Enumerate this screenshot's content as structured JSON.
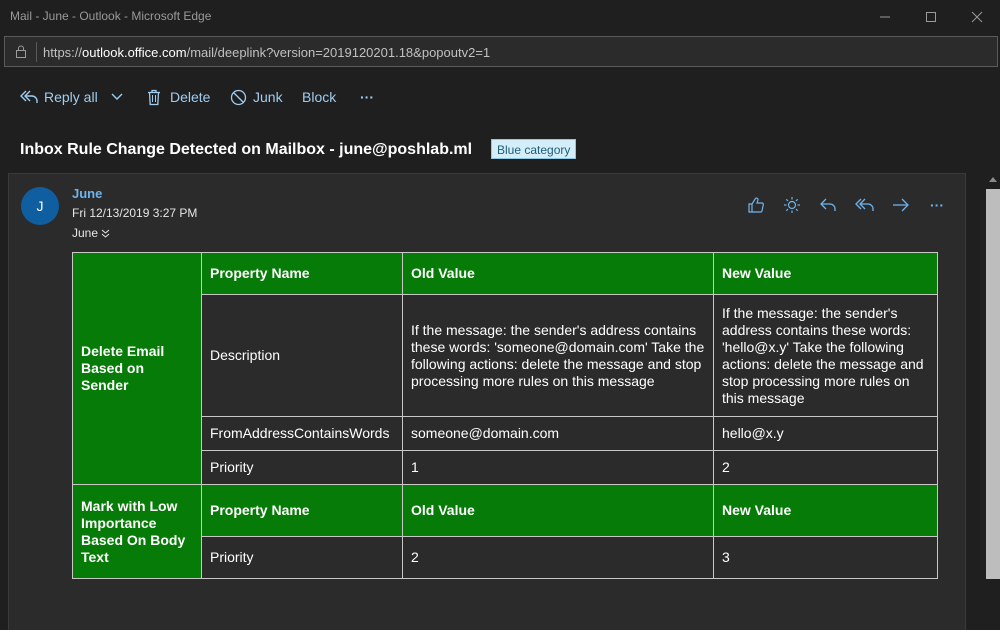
{
  "window": {
    "title": "Mail - June - Outlook - Microsoft Edge",
    "minimize_icon": "minimize-icon",
    "maximize_icon": "maximize-icon",
    "close_icon": "close-icon"
  },
  "address_bar": {
    "url_prefix": "https://",
    "url_host": "outlook.office.com",
    "url_path": "/mail/deeplink?version=2019120201.18&popoutv2=1"
  },
  "toolbar": {
    "reply_all": "Reply all",
    "delete": "Delete",
    "junk": "Junk",
    "block": "Block",
    "more": "···"
  },
  "message": {
    "subject": "Inbox Rule Change Detected on Mailbox - june@poshlab.ml",
    "category": "Blue category",
    "avatar_initial": "J",
    "sender": "June",
    "date": "Fri 12/13/2019 3:27 PM",
    "to": "June",
    "actions": [
      "like-icon",
      "sun-icon",
      "reply-icon",
      "reply-all-icon",
      "forward-icon",
      "more-icon"
    ],
    "actions_more": "···"
  },
  "rules_table": {
    "rules": [
      {
        "name": "Delete Email Based on Sender",
        "headers": [
          "Property Name",
          "Old Value",
          "New Value"
        ],
        "rows": [
          [
            "Description",
            "If the message: the sender's address contains these words: 'someone@domain.com' Take the following actions: delete the message and stop processing more rules on this message",
            "If the message: the sender's address contains these words: 'hello@x.y' Take the following actions: delete the message and stop processing more rules on this message"
          ],
          [
            "FromAddressContainsWords",
            "someone@domain.com",
            "hello@x.y"
          ],
          [
            "Priority",
            "1",
            "2"
          ]
        ]
      },
      {
        "name": "Mark with Low Importance Based On Body Text",
        "headers": [
          "Property Name",
          "Old Value",
          "New Value"
        ],
        "rows": [
          [
            "Priority",
            "2",
            "3"
          ]
        ]
      }
    ]
  },
  "colors": {
    "accent": "#6fb3ec",
    "header_green": "#077b07",
    "avatar_blue": "#0f5ea0",
    "background": "#1f1f1f",
    "pane": "#2b2b2b"
  }
}
